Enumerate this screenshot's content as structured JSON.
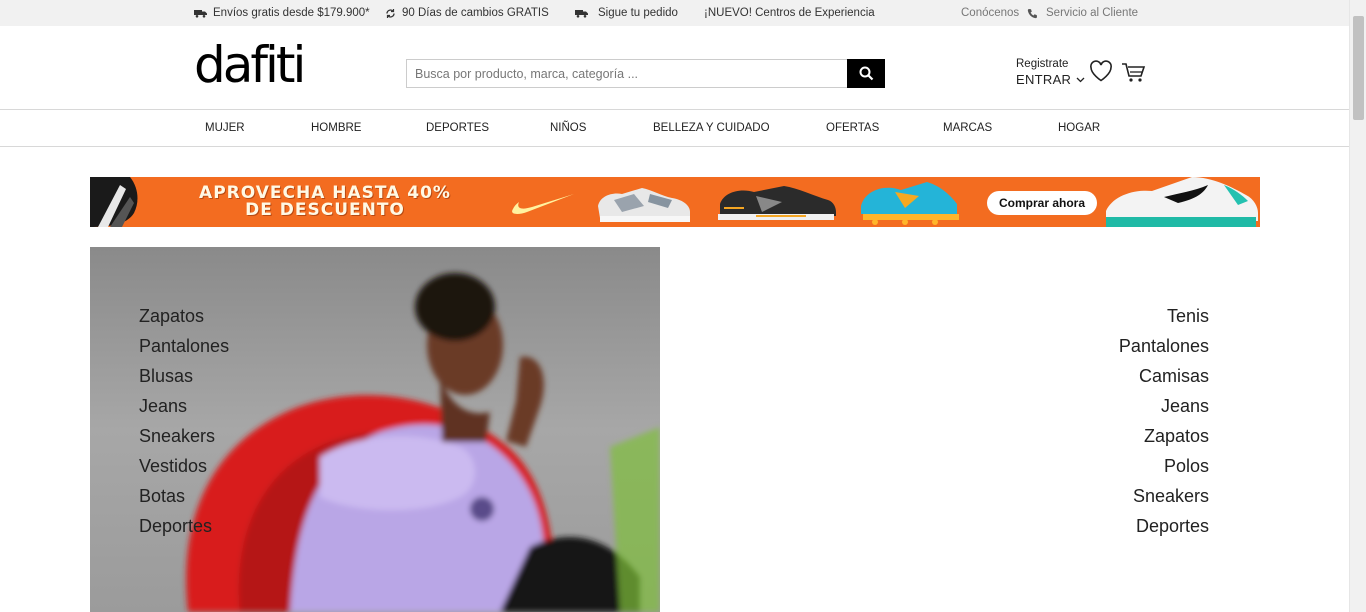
{
  "topbar": {
    "shipping": "Envíos gratis desde $179.900*",
    "returns": "90 Días de cambios GRATIS",
    "tracking": "Sigue tu pedido",
    "experience": "¡NUEVO! Centros de Experiencia",
    "about": "Conócenos",
    "support": "Servicio al Cliente"
  },
  "header": {
    "logo": "dafiti",
    "search_placeholder": "Busca por producto, marca, categoría ...",
    "register": "Registrate",
    "login": "ENTRAR"
  },
  "nav": {
    "items": [
      "MUJER",
      "HOMBRE",
      "DEPORTES",
      "NIÑOS",
      "BELLEZA Y CUIDADO",
      "OFERTAS",
      "MARCAS",
      "HOGAR"
    ]
  },
  "banner": {
    "line1": "APROVECHA HASTA 40%",
    "line2": "DE DESCUENTO",
    "cta": "Comprar ahora",
    "color": "#f36c20"
  },
  "women_categories": [
    "Zapatos",
    "Pantalones",
    "Blusas",
    "Jeans",
    "Sneakers",
    "Vestidos",
    "Botas",
    "Deportes"
  ],
  "men_categories": [
    "Tenis",
    "Pantalones",
    "Camisas",
    "Jeans",
    "Zapatos",
    "Polos",
    "Sneakers",
    "Deportes"
  ]
}
